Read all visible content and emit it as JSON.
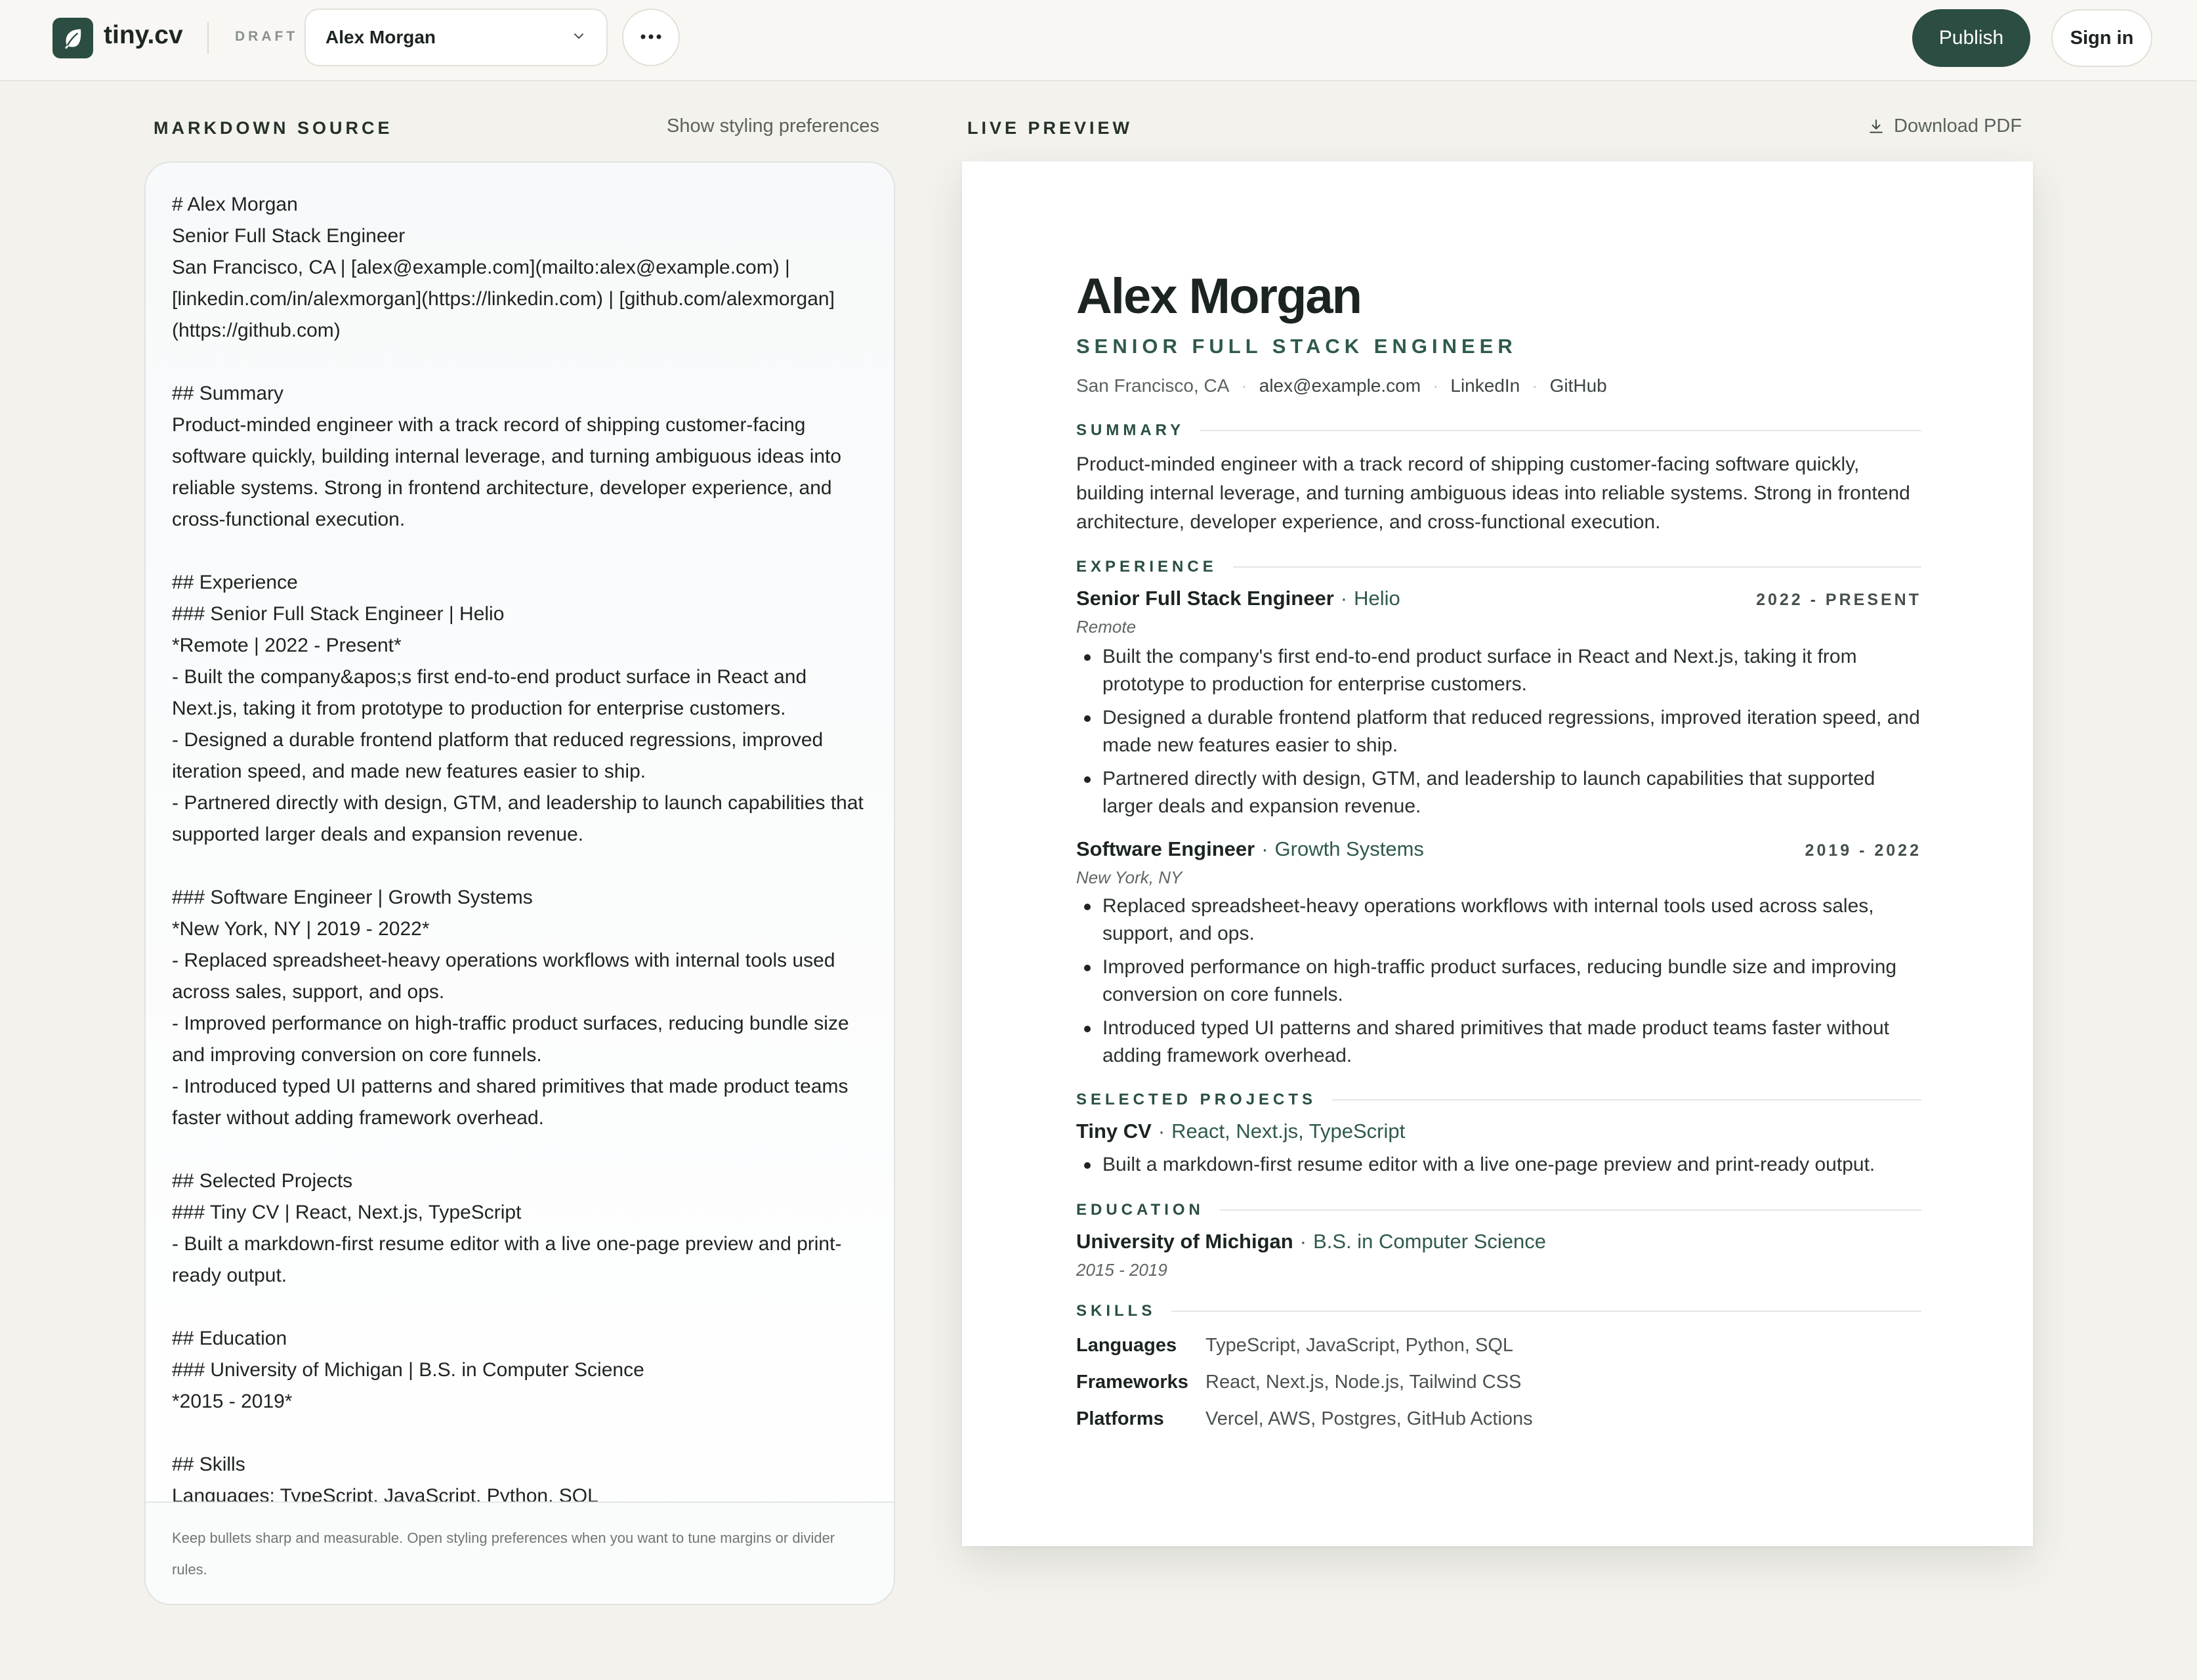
{
  "app": {
    "logo_text": "tiny.cv",
    "status": "DRAFT",
    "document_name": "Alex Morgan",
    "publish_label": "Publish",
    "signin_label": "Sign in"
  },
  "editor": {
    "section_label": "MARKDOWN SOURCE",
    "styling_link": "Show styling preferences",
    "source": "# Alex Morgan\nSenior Full Stack Engineer\nSan Francisco, CA | [alex@example.com](mailto:alex@example.com) |\n[linkedin.com/in/alexmorgan](https://linkedin.com) | [github.com/alexmorgan]\n(https://github.com)\n\n## Summary\nProduct-minded engineer with a track record of shipping customer-facing\nsoftware quickly, building internal leverage, and turning ambiguous ideas into\nreliable systems. Strong in frontend architecture, developer experience, and\ncross-functional execution.\n\n## Experience\n### Senior Full Stack Engineer | Helio\n*Remote | 2022 - Present*\n- Built the company&apos;s first end-to-end product surface in React and\nNext.js, taking it from prototype to production for enterprise customers.\n- Designed a durable frontend platform that reduced regressions, improved\niteration speed, and made new features easier to ship.\n- Partnered directly with design, GTM, and leadership to launch capabilities that\nsupported larger deals and expansion revenue.\n\n### Software Engineer | Growth Systems\n*New York, NY | 2019 - 2022*\n- Replaced spreadsheet-heavy operations workflows with internal tools used\nacross sales, support, and ops.\n- Improved performance on high-traffic product surfaces, reducing bundle size\nand improving conversion on core funnels.\n- Introduced typed UI patterns and shared primitives that made product teams\nfaster without adding framework overhead.\n\n## Selected Projects\n### Tiny CV | React, Next.js, TypeScript\n- Built a markdown-first resume editor with a live one-page preview and print-\nready output.\n\n## Education\n### University of Michigan | B.S. in Computer Science\n*2015 - 2019*\n\n## Skills\nLanguages: TypeScript, JavaScript, Python, SQL",
    "footer_hint": "Keep bullets sharp and measurable. Open styling preferences when you want to tune margins or divider rules."
  },
  "preview": {
    "section_label": "LIVE PREVIEW",
    "download_label": "Download PDF",
    "name": "Alex Morgan",
    "title": "SENIOR FULL STACK ENGINEER",
    "contact": {
      "location": "San Francisco, CA",
      "email": "alex@example.com",
      "linkedin": "LinkedIn",
      "github": "GitHub"
    },
    "summary_heading": "SUMMARY",
    "summary": "Product-minded engineer with a track record of shipping customer-facing software quickly, building internal leverage, and turning ambiguous ideas into reliable systems. Strong in frontend architecture, developer experience, and cross-functional execution.",
    "experience_heading": "EXPERIENCE",
    "jobs": [
      {
        "title": "Senior Full Stack Engineer",
        "org": "Helio",
        "dates": "2022 - PRESENT",
        "location": "Remote",
        "bullets": [
          "Built the company's first end-to-end product surface in React and Next.js, taking it from prototype to production for enterprise customers.",
          "Designed a durable frontend platform that reduced regressions, improved iteration speed, and made new features easier to ship.",
          "Partnered directly with design, GTM, and leadership to launch capabilities that supported larger deals and expansion revenue."
        ]
      },
      {
        "title": "Software Engineer",
        "org": "Growth Systems",
        "dates": "2019 - 2022",
        "location": "New York, NY",
        "bullets": [
          "Replaced spreadsheet-heavy operations workflows with internal tools used across sales, support, and ops.",
          "Improved performance on high-traffic product surfaces, reducing bundle size and improving conversion on core funnels.",
          "Introduced typed UI patterns and shared primitives that made product teams faster without adding framework overhead."
        ]
      }
    ],
    "projects_heading": "SELECTED PROJECTS",
    "project": {
      "name": "Tiny CV",
      "stack": "React, Next.js, TypeScript",
      "bullet": "Built a markdown-first resume editor with a live one-page preview and print-ready output."
    },
    "education_heading": "EDUCATION",
    "education": {
      "school": "University of Michigan",
      "degree": "B.S. in Computer Science",
      "dates": "2015 - 2019"
    },
    "skills_heading": "SKILLS",
    "skills": [
      {
        "key": "Languages",
        "value": "TypeScript, JavaScript, Python, SQL"
      },
      {
        "key": "Frameworks",
        "value": "React, Next.js, Node.js, Tailwind CSS"
      },
      {
        "key": "Platforms",
        "value": "Vercel, AWS, Postgres, GitHub Actions"
      }
    ]
  },
  "icons": {
    "logo": "leaf-icon",
    "select": "chevron-down-icon",
    "more": "ellipsis-icon",
    "download": "download-icon"
  },
  "colors": {
    "brand": "#2c4d41",
    "accent_text": "#2f5a4b",
    "background": "#f3f2ed"
  }
}
